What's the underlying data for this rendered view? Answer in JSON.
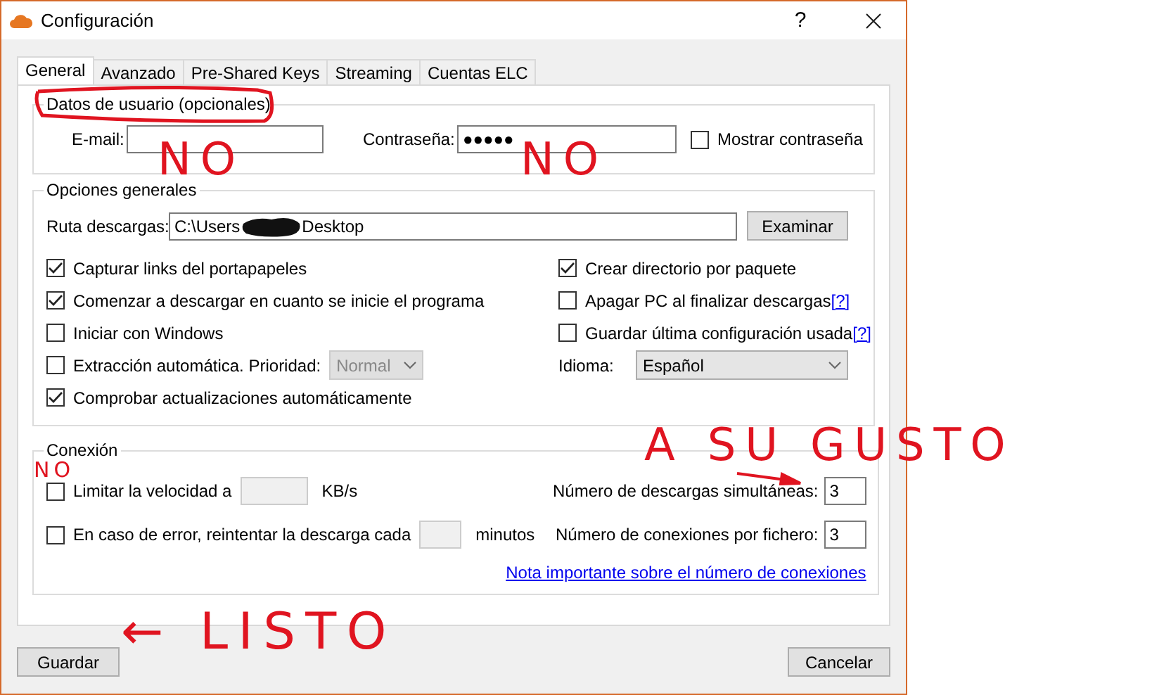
{
  "window": {
    "title": "Configuración",
    "help": "?"
  },
  "tabs": [
    {
      "label": "General",
      "selected": true
    },
    {
      "label": "Avanzado",
      "selected": false
    },
    {
      "label": "Pre-Shared Keys",
      "selected": false
    },
    {
      "label": "Streaming",
      "selected": false
    },
    {
      "label": "Cuentas ELC",
      "selected": false
    }
  ],
  "user_group": {
    "title": "Datos de usuario (opcionales)",
    "email_label": "E-mail:",
    "password_label": "Contraseña:",
    "password_value": "●●●●●",
    "show_password": {
      "label": "Mostrar contraseña",
      "checked": false
    }
  },
  "general_group": {
    "title": "Opciones generales",
    "path_label": "Ruta descargas:",
    "path_start": "C:\\Users",
    "path_end": "Desktop",
    "browse": "Examinar",
    "left_options": [
      {
        "kind": "check",
        "label": "Capturar links del portapapeles",
        "checked": true
      },
      {
        "kind": "check",
        "label": "Comenzar a descargar en cuanto se inicie el programa",
        "checked": true
      },
      {
        "kind": "check",
        "label": "Iniciar con Windows",
        "checked": false
      },
      {
        "kind": "check_select",
        "label": "Extracción automática. Prioridad:",
        "checked": false,
        "select_value": "Normal",
        "disabled": true
      },
      {
        "kind": "check",
        "label": "Comprobar actualizaciones automáticamente",
        "checked": true
      }
    ],
    "right_options": [
      {
        "kind": "check",
        "label": "Crear directorio por paquete",
        "checked": true
      },
      {
        "kind": "check_help",
        "label": "Apagar PC al finalizar descargas",
        "checked": false,
        "help": "[?]"
      },
      {
        "kind": "check_help",
        "label": "Guardar última configuración usada",
        "checked": false,
        "help": "[?]"
      }
    ],
    "language_label": "Idioma:",
    "language_value": "Español"
  },
  "connection_group": {
    "title": "Conexión",
    "left_options": [
      {
        "label": "Limitar la velocidad a",
        "unit": "KB/s",
        "checked": false
      },
      {
        "label": "En caso de error, reintentar la descarga cada",
        "unit": "minutos",
        "checked": false
      }
    ],
    "right_fields": [
      {
        "label": "Número de descargas simultáneas:",
        "value": "3"
      },
      {
        "label": "Número de conexiones por fichero:",
        "value": "3"
      }
    ],
    "link": "Nota importante sobre el número de conexiones"
  },
  "buttons": {
    "save": "Guardar",
    "cancel": "Cancelar"
  },
  "annotations": [
    {
      "kind": "circle"
    },
    {
      "kind": "text",
      "text": "NO"
    },
    {
      "kind": "text",
      "text": "NO"
    },
    {
      "kind": "text",
      "text": "A SU GUSTO"
    },
    {
      "kind": "arrow"
    },
    {
      "kind": "text",
      "text": "NO"
    },
    {
      "kind": "text",
      "text": "← LISTO"
    }
  ]
}
